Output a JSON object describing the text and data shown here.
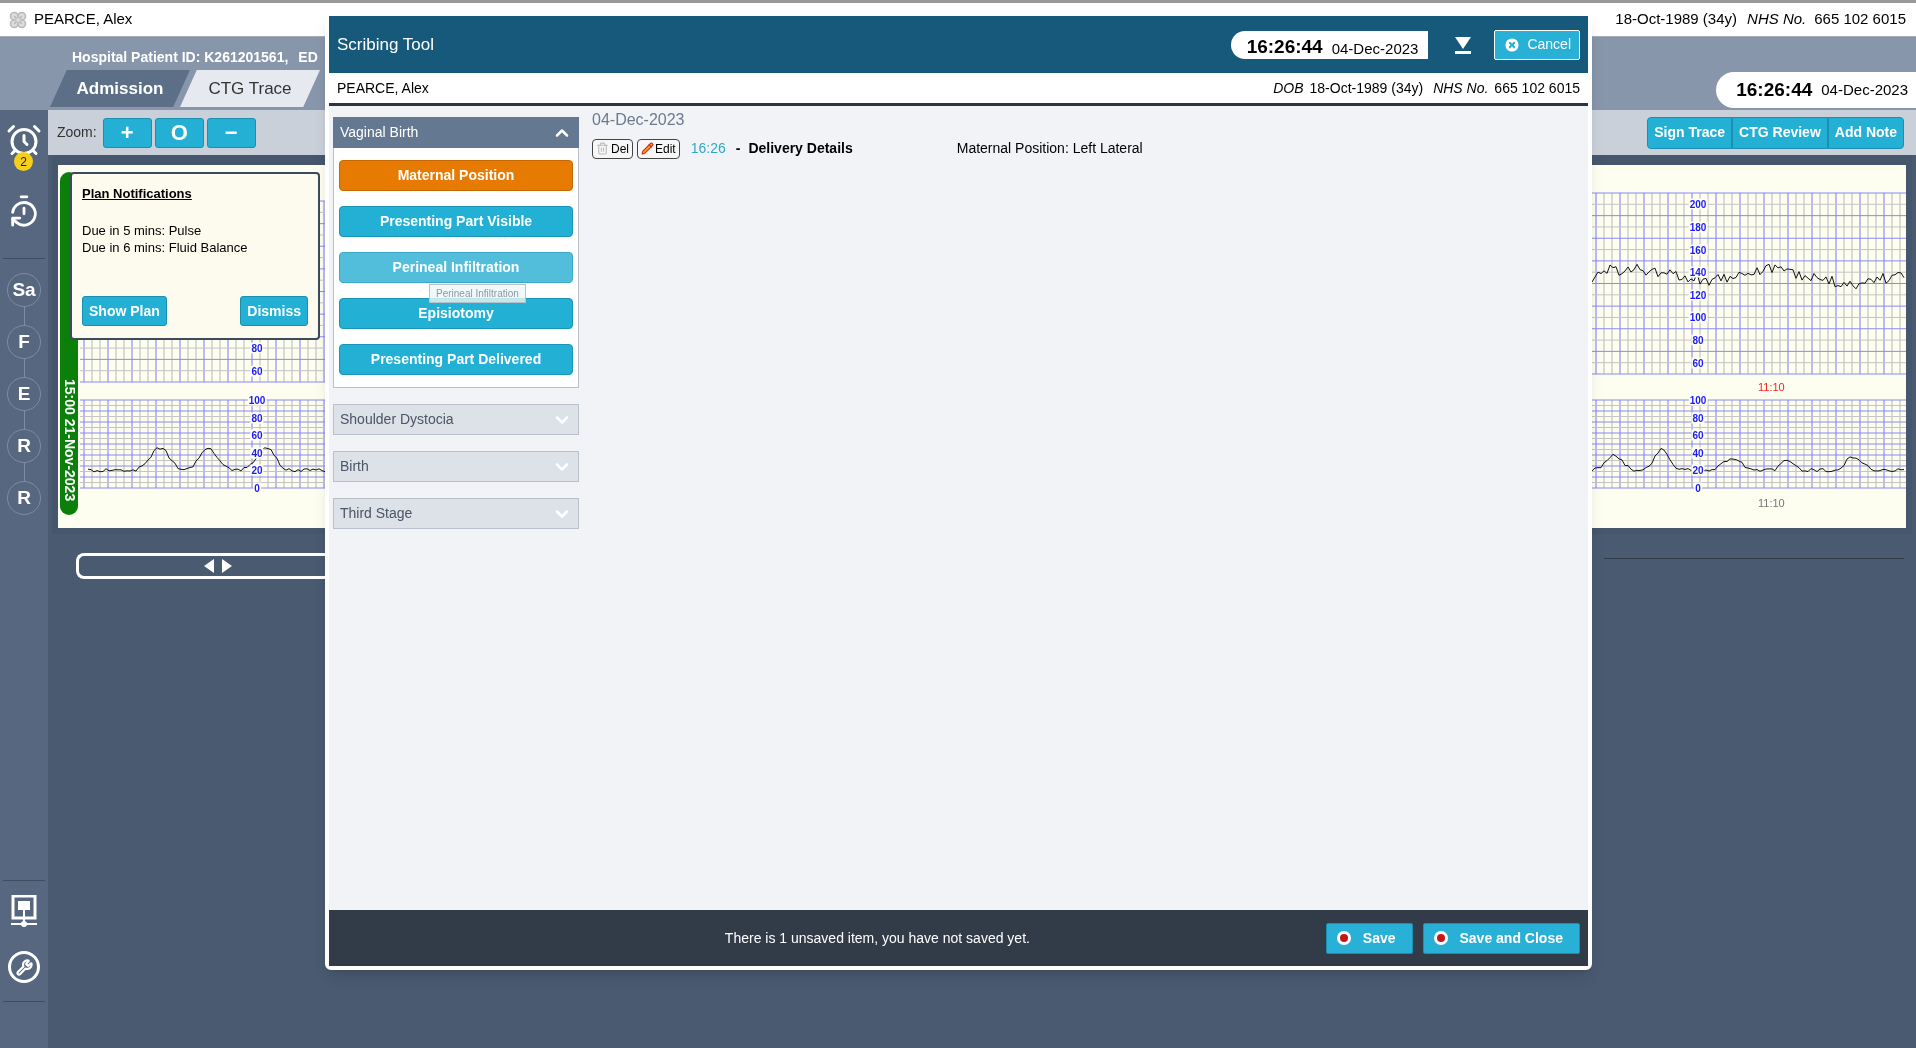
{
  "top_bar": {
    "name": "PEARCE, Alex",
    "dob": "18-Oct-1989 (34y)",
    "nhs_label": "NHS No.",
    "nhs_number": "665 102 6015"
  },
  "header": {
    "patient_id": "Hospital Patient ID: K261201561,",
    "edd": "ED"
  },
  "tabs": [
    {
      "label": "Admission",
      "selected": false
    },
    {
      "label": "CTG Trace",
      "selected": true
    }
  ],
  "clock": {
    "time": "16:26:44",
    "date": "04-Dec-2023"
  },
  "sidebar": {
    "alarm_badge": "2",
    "steps": [
      "Sa",
      "F",
      "E",
      "R",
      "R"
    ]
  },
  "toolbar": {
    "zoom_label": "Zoom:",
    "zoom_buttons": [
      "+",
      "O",
      "−"
    ],
    "actions": [
      "Sign Trace",
      "CTG Review",
      "Add Note"
    ]
  },
  "ctg": {
    "connect_label": "15:00 21-Nov-2023",
    "left_fhr_labels": [
      "80",
      "60"
    ],
    "left_toco_labels": [
      "100",
      "80",
      "60",
      "40",
      "20",
      "0"
    ],
    "right_fhr_labels": [
      "200",
      "180",
      "160",
      "140",
      "120",
      "100",
      "80",
      "60"
    ],
    "right_toco_labels": [
      "100",
      "80",
      "60",
      "40",
      "20",
      "0"
    ],
    "fhr_time": "11:10",
    "toco_time": "11:10"
  },
  "plan_notifications": {
    "title": "Plan Notifications",
    "lines": [
      "Due in 5 mins: Pulse",
      "Due in 6 mins: Fluid Balance"
    ],
    "buttons": [
      "Show Plan",
      "Dismiss"
    ]
  },
  "scribing_tool": {
    "title": "Scribing Tool",
    "clock": {
      "time": "16:26:44",
      "date": "04-Dec-2023"
    },
    "cancel": "Cancel",
    "patient": {
      "name": "PEARCE, Alex",
      "dob_label": "DOB",
      "dob": "18-Oct-1989 (34y)",
      "nhs_label": "NHS No.",
      "nhs_number": "665 102 6015"
    },
    "sections": [
      {
        "title": "Vaginal Birth",
        "expanded": true,
        "items": [
          {
            "label": "Maternal Position",
            "selected": true,
            "hovered": false
          },
          {
            "label": "Presenting Part Visible",
            "selected": false,
            "hovered": false
          },
          {
            "label": "Perineal Infiltration",
            "selected": false,
            "hovered": true
          },
          {
            "label": "Episiotomy",
            "selected": false,
            "hovered": false
          },
          {
            "label": "Presenting Part Delivered",
            "selected": false,
            "hovered": false
          }
        ]
      },
      {
        "title": "Shoulder Dystocia",
        "expanded": false
      },
      {
        "title": "Birth",
        "expanded": false
      },
      {
        "title": "Third Stage",
        "expanded": false
      }
    ],
    "tooltip": "Perineal Infiltration",
    "entries_date": "04-Dec-2023",
    "entries": [
      {
        "delete": "Del",
        "edit": "Edit",
        "time": "16:26",
        "dash": "-",
        "title": "Delivery Details",
        "detail": "Maternal Position: Left Lateral"
      }
    ],
    "footer": {
      "message": "There is 1 unsaved item, you have not saved yet.",
      "buttons": [
        "Save",
        "Save and Close"
      ]
    }
  }
}
